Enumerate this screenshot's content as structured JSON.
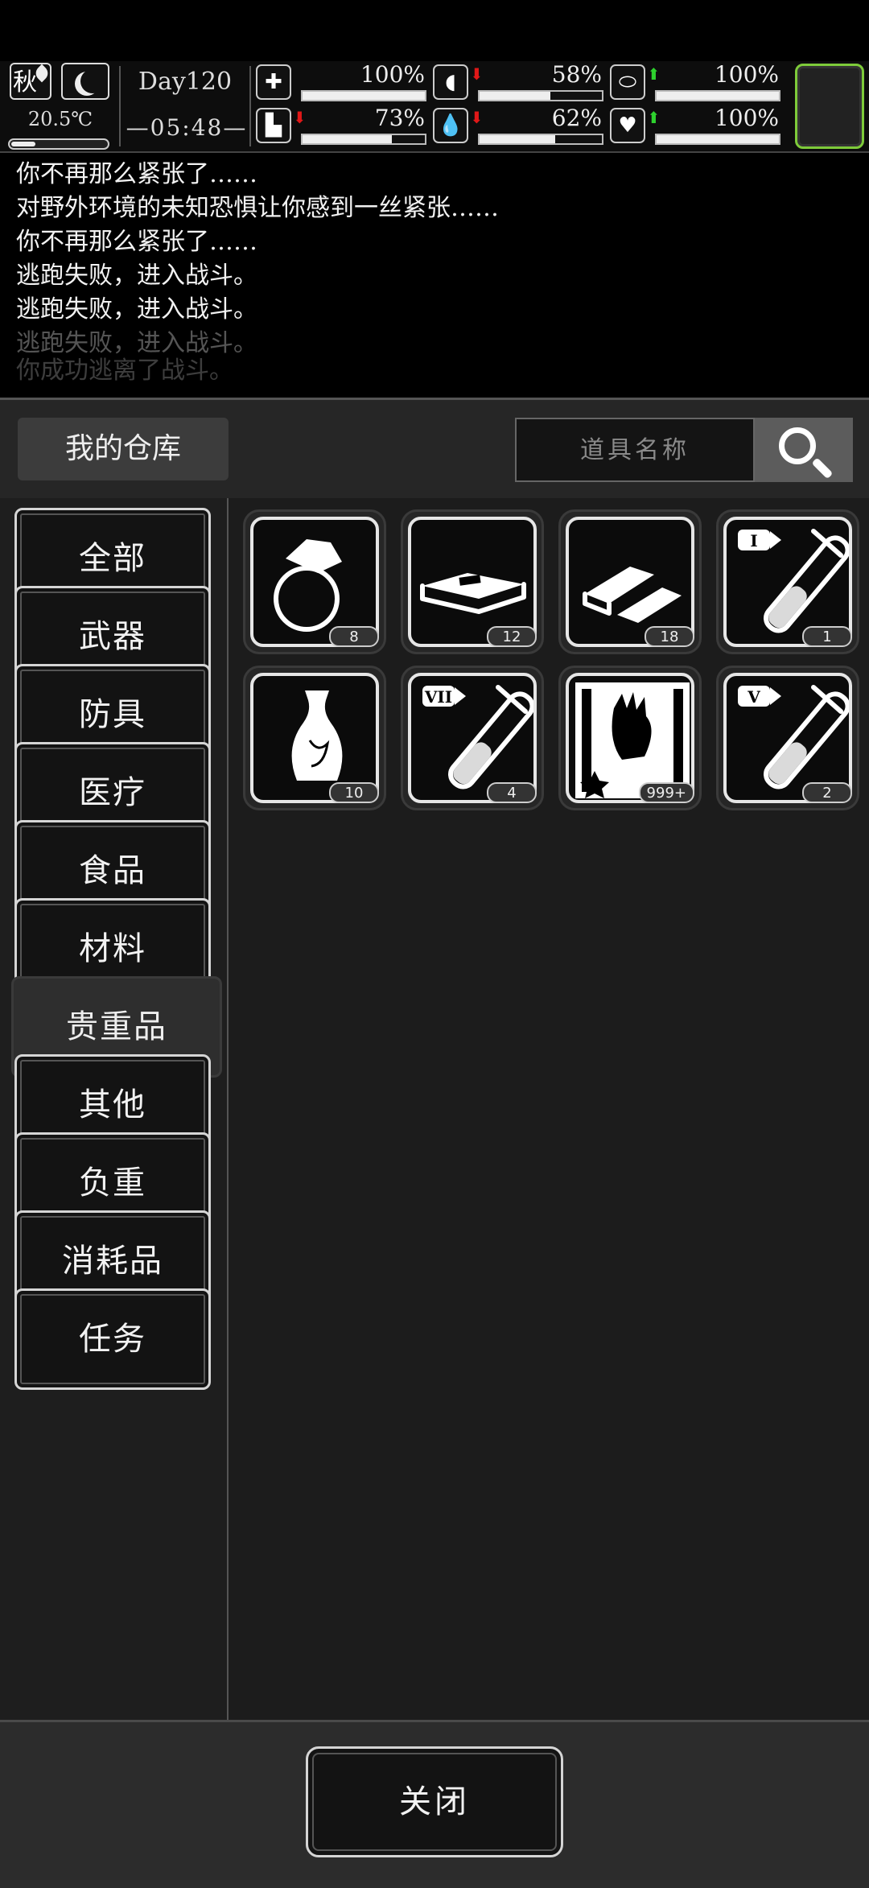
{
  "hud": {
    "season": "秋",
    "temperature": "20.5℃",
    "temperature_level": 0.25,
    "day": "Day120",
    "time": "—05:48—",
    "stats": [
      {
        "name": "health",
        "icon": "medkit-icon",
        "value": "100%",
        "level": 1.0,
        "trend": "none"
      },
      {
        "name": "hunger",
        "icon": "stomach-icon",
        "value": "58%",
        "level": 0.58,
        "trend": "down"
      },
      {
        "name": "energy",
        "icon": "pill-icon",
        "value": "100%",
        "level": 1.0,
        "trend": "up"
      },
      {
        "name": "stamina",
        "icon": "foot-icon",
        "value": "73%",
        "level": 0.73,
        "trend": "down"
      },
      {
        "name": "thirst",
        "icon": "water-drop-icon",
        "value": "62%",
        "level": 0.62,
        "trend": "down"
      },
      {
        "name": "mood",
        "icon": "heart-icon",
        "value": "100%",
        "level": 1.0,
        "trend": "up"
      }
    ],
    "accent_color": "#7ecb3a",
    "down_color": "#e01818",
    "up_color": "#2ed12e"
  },
  "log": [
    "你不再那么紧张了……",
    "对野外环境的未知恐惧让你感到一丝紧张……",
    "你不再那么紧张了……",
    "逃跑失败，进入战斗。",
    "逃跑失败，进入战斗。",
    "逃跑失败，进入战斗。",
    "你成功逃离了战斗。"
  ],
  "warehouse": {
    "title": "我的仓库",
    "search_placeholder": "道具名称",
    "categories": [
      "全部",
      "武器",
      "防具",
      "医疗",
      "食品",
      "材料",
      "贵重品",
      "其他",
      "负重",
      "消耗品",
      "任务"
    ],
    "active_category": "贵重品",
    "items": [
      {
        "icon": "ring-icon",
        "count": "8"
      },
      {
        "icon": "cash-stack-icon",
        "count": "12"
      },
      {
        "icon": "gold-bars-icon",
        "count": "18"
      },
      {
        "icon": "potion-tube-i-icon",
        "count": "1"
      },
      {
        "icon": "vase-icon",
        "count": "10"
      },
      {
        "icon": "potion-tube-vii-icon",
        "count": "4"
      },
      {
        "icon": "zombie-poster-icon",
        "count": "999+"
      },
      {
        "icon": "potion-tube-v-icon",
        "count": "2"
      }
    ],
    "tube_labels": [
      "I",
      "VII",
      "V"
    ],
    "close_label": "关闭"
  }
}
